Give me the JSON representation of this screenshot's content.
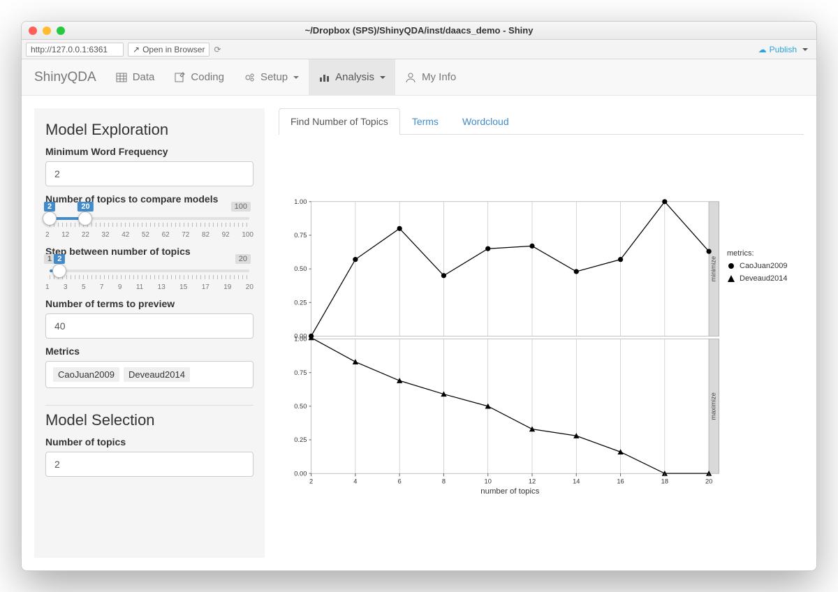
{
  "window": {
    "title": "~/Dropbox (SPS)/ShinyQDA/inst/daacs_demo - Shiny",
    "url": "http://127.0.0.1:6361",
    "open_browser": "Open in Browser",
    "publish": "Publish"
  },
  "navbar": {
    "brand": "ShinyQDA",
    "data": "Data",
    "coding": "Coding",
    "setup": "Setup",
    "analysis": "Analysis",
    "myinfo": "My Info"
  },
  "sidebar": {
    "section1": "Model Exploration",
    "min_word_freq_label": "Minimum Word Frequency",
    "min_word_freq_value": "2",
    "ntopics_label": "Number of topics to compare models",
    "ntopics_min": "2",
    "ntopics_val": "20",
    "ntopics_max": "100",
    "ntopics_ticks": [
      "2",
      "12",
      "22",
      "32",
      "42",
      "52",
      "62",
      "72",
      "82",
      "92",
      "100"
    ],
    "step_label": "Step between number of topics",
    "step_min": "1",
    "step_val": "2",
    "step_max": "20",
    "step_ticks": [
      "1",
      "3",
      "5",
      "7",
      "9",
      "11",
      "13",
      "15",
      "17",
      "19",
      "20"
    ],
    "nterms_label": "Number of terms to preview",
    "nterms_value": "40",
    "metrics_label": "Metrics",
    "metrics": [
      "CaoJuan2009",
      "Deveaud2014"
    ],
    "section2": "Model Selection",
    "ntopics2_label": "Number of topics",
    "ntopics2_value": "2"
  },
  "tabs": {
    "t1": "Find Number of Topics",
    "t2": "Terms",
    "t3": "Wordcloud"
  },
  "legend": {
    "title": "metrics:",
    "m1": "CaoJuan2009",
    "m2": "Deveaud2014"
  },
  "chart_data": [
    {
      "type": "line",
      "facet_label": "minimize",
      "series_name": "CaoJuan2009",
      "marker": "circle",
      "x": [
        2,
        4,
        6,
        8,
        10,
        12,
        14,
        16,
        18,
        20
      ],
      "values": [
        0.0,
        0.57,
        0.8,
        0.45,
        0.65,
        0.67,
        0.48,
        0.57,
        1.0,
        0.63
      ],
      "ylim": [
        0.0,
        1.0
      ],
      "yticks": [
        0.0,
        0.25,
        0.5,
        0.75,
        1.0
      ]
    },
    {
      "type": "line",
      "facet_label": "maximize",
      "series_name": "Deveaud2014",
      "marker": "triangle",
      "x": [
        2,
        4,
        6,
        8,
        10,
        12,
        14,
        16,
        18,
        20
      ],
      "values": [
        1.01,
        0.83,
        0.69,
        0.59,
        0.5,
        0.33,
        0.28,
        0.16,
        0.0,
        0.0
      ],
      "ylim": [
        0.0,
        1.0
      ],
      "yticks": [
        0.0,
        0.25,
        0.5,
        0.75,
        1.0
      ]
    }
  ],
  "chart_meta": {
    "xlabel": "number of topics",
    "xticks": [
      2,
      4,
      6,
      8,
      10,
      12,
      14,
      16,
      18,
      20
    ]
  }
}
